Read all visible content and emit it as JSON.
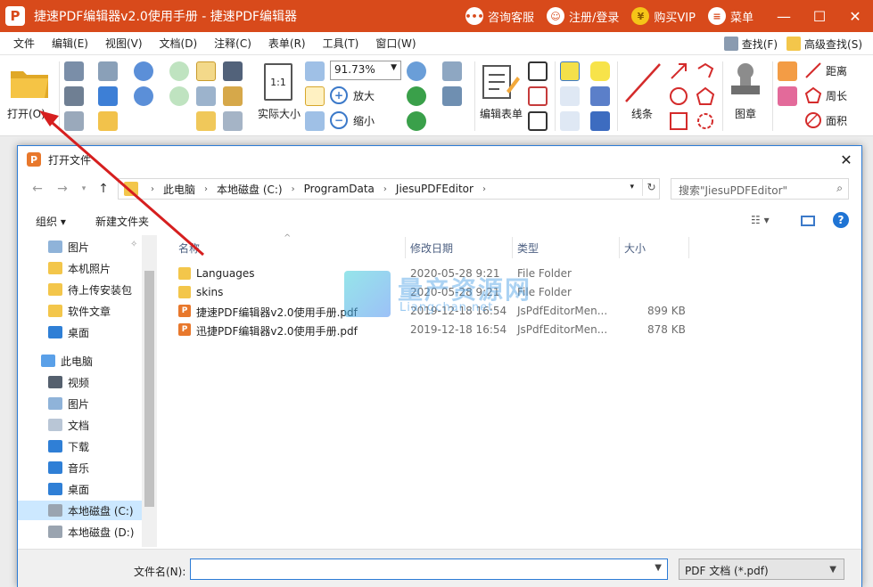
{
  "window": {
    "title": "捷速PDF编辑器v2.0使用手册 - 捷速PDF编辑器",
    "support": "咨询客服",
    "login": "注册/登录",
    "vip": "购买VIP",
    "menu": "菜单",
    "minimize": "—",
    "maximize": "☐",
    "close": "✕",
    "accent": "#d84a1b"
  },
  "menubar": {
    "items": [
      "文件",
      "编辑(E)",
      "视图(V)",
      "文档(D)",
      "注释(C)",
      "表单(R)",
      "工具(T)",
      "窗口(W)"
    ],
    "find": "查找(F)",
    "advanced_find": "高级查找(S)"
  },
  "toolbar": {
    "open": "打开(O)",
    "zoom": "91.73%",
    "actual_size": "实际大小",
    "zoom_in": "放大",
    "zoom_out": "缩小",
    "edit_form": "编辑表单",
    "line": "线条",
    "stamp": "图章",
    "distance": "距离",
    "perimeter": "周长",
    "area": "面积"
  },
  "dialog": {
    "title": "打开文件",
    "breadcrumb": [
      "此电脑",
      "本地磁盘 (C:)",
      "ProgramData",
      "JiesuPDFEditor"
    ],
    "search_placeholder": "搜索\"JiesuPDFEditor\"",
    "organize": "组织 ▾",
    "new_folder": "新建文件夹",
    "columns": [
      "名称",
      "修改日期",
      "类型",
      "大小"
    ],
    "nav": [
      {
        "label": "图片",
        "icon": "pictures-icon"
      },
      {
        "label": "本机照片",
        "icon": "folder-icon"
      },
      {
        "label": "待上传安装包",
        "icon": "folder-icon"
      },
      {
        "label": "软件文章",
        "icon": "folder-icon"
      },
      {
        "label": "桌面",
        "icon": "desktop-icon"
      },
      {
        "label": "此电脑",
        "icon": "computer-icon"
      },
      {
        "label": "视频",
        "icon": "video-icon"
      },
      {
        "label": "图片",
        "icon": "pictures-icon"
      },
      {
        "label": "文档",
        "icon": "documents-icon"
      },
      {
        "label": "下载",
        "icon": "download-icon"
      },
      {
        "label": "音乐",
        "icon": "music-icon"
      },
      {
        "label": "桌面",
        "icon": "desktop-icon"
      },
      {
        "label": "本地磁盘 (C:)",
        "icon": "drive-icon"
      },
      {
        "label": "本地磁盘 (D:)",
        "icon": "drive-icon"
      }
    ],
    "files": [
      {
        "name": "Languages",
        "date": "2020-05-28 9:21",
        "type": "File Folder",
        "size": "",
        "kind": "folder"
      },
      {
        "name": "skins",
        "date": "2020-05-28 9:21",
        "type": "File Folder",
        "size": "",
        "kind": "folder"
      },
      {
        "name": "捷速PDF编辑器v2.0使用手册.pdf",
        "date": "2019-12-18 16:54",
        "type": "JsPdfEditorMen...",
        "size": "899 KB",
        "kind": "pdf"
      },
      {
        "name": "迅捷PDF编辑器v2.0使用手册.pdf",
        "date": "2019-12-18 16:54",
        "type": "JsPdfEditorMen...",
        "size": "878 KB",
        "kind": "pdf"
      }
    ],
    "filename_label": "文件名(N):",
    "filename_value": "",
    "filetype": "PDF 文档 (*.pdf)"
  },
  "watermark": {
    "text": "量产资源网",
    "sub": "Liangchan.net"
  }
}
